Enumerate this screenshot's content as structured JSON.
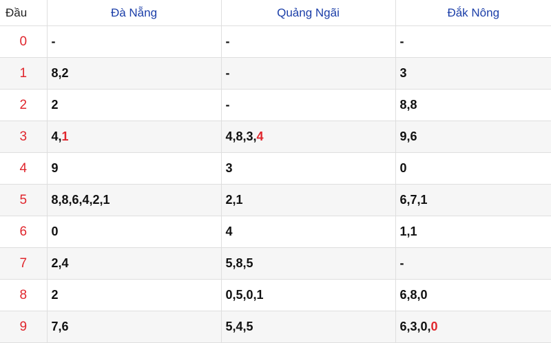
{
  "header": {
    "dau_label": "Đầu",
    "provinces": [
      "Đà Nẵng",
      "Quảng Ngãi",
      "Đắk Nông"
    ]
  },
  "rows": [
    {
      "dau": "0",
      "cells": [
        {
          "text": "-",
          "hl": ""
        },
        {
          "text": "-",
          "hl": ""
        },
        {
          "text": "-",
          "hl": ""
        }
      ]
    },
    {
      "dau": "1",
      "cells": [
        {
          "text": "8,2",
          "hl": ""
        },
        {
          "text": "-",
          "hl": ""
        },
        {
          "text": "3",
          "hl": ""
        }
      ]
    },
    {
      "dau": "2",
      "cells": [
        {
          "text": "2",
          "hl": ""
        },
        {
          "text": "-",
          "hl": ""
        },
        {
          "text": "8,8",
          "hl": ""
        }
      ]
    },
    {
      "dau": "3",
      "cells": [
        {
          "text": "4,",
          "hl": "1"
        },
        {
          "text": "4,8,3,",
          "hl": "4"
        },
        {
          "text": "9,6",
          "hl": ""
        }
      ]
    },
    {
      "dau": "4",
      "cells": [
        {
          "text": "9",
          "hl": ""
        },
        {
          "text": "3",
          "hl": ""
        },
        {
          "text": "0",
          "hl": ""
        }
      ]
    },
    {
      "dau": "5",
      "cells": [
        {
          "text": "8,8,6,4,2,1",
          "hl": ""
        },
        {
          "text": "2,1",
          "hl": ""
        },
        {
          "text": "6,7,1",
          "hl": ""
        }
      ]
    },
    {
      "dau": "6",
      "cells": [
        {
          "text": "0",
          "hl": ""
        },
        {
          "text": "4",
          "hl": ""
        },
        {
          "text": "1,1",
          "hl": ""
        }
      ]
    },
    {
      "dau": "7",
      "cells": [
        {
          "text": "2,4",
          "hl": ""
        },
        {
          "text": "5,8,5",
          "hl": ""
        },
        {
          "text": "-",
          "hl": ""
        }
      ]
    },
    {
      "dau": "8",
      "cells": [
        {
          "text": "2",
          "hl": ""
        },
        {
          "text": "0,5,0,1",
          "hl": ""
        },
        {
          "text": "6,8,0",
          "hl": ""
        }
      ]
    },
    {
      "dau": "9",
      "cells": [
        {
          "text": "7,6",
          "hl": ""
        },
        {
          "text": "5,4,5",
          "hl": ""
        },
        {
          "text": "6,3,0,",
          "hl": "0"
        }
      ]
    }
  ],
  "colors": {
    "header_text": "#1b3ea8",
    "highlight": "#e0262d",
    "row_alt": "#f6f6f6"
  }
}
